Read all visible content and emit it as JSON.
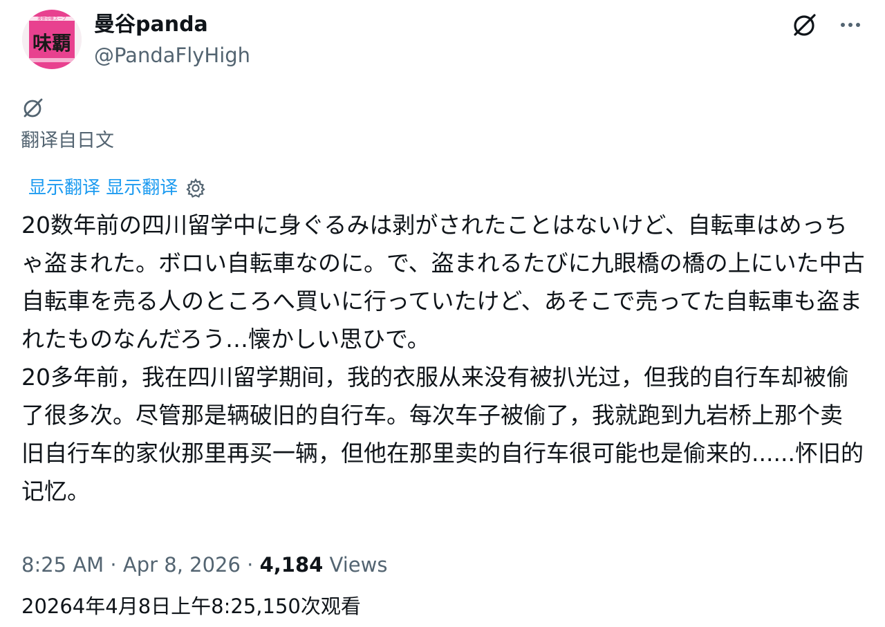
{
  "author": {
    "display_name": "曼谷panda",
    "handle": "@PandaFlyHigh",
    "avatar": {
      "label": "味覇",
      "top_text": "液体中華スープ",
      "bg_color": "#e8418f"
    }
  },
  "header_icons": {
    "grok_icon": "slash-circle-icon",
    "more_icon": "more-horizontal-icon"
  },
  "translation": {
    "icon": "slash-circle-icon",
    "translated_from": "翻译自日文",
    "show_translation": "显示翻译 显示翻译"
  },
  "post": {
    "original_text": "20数年前の四川留学中に身ぐるみは剥がされたことはないけど、自転車はめっちゃ盗まれた。ボロい自転車なのに。で、盗まれるたびに九眼橋の橋の上にいた中古自転車を売る人のところへ買いに行っていたけど、あそこで売ってた自転車も盗まれたものなんだろう…懐かしい思ひで。",
    "translated_text": "20多年前，我在四川留学期间，我的衣服从来没有被扒光过，但我的自行车却被偷了很多次。尽管那是辆破旧的自行车。每次车子被偷了，我就跑到九岩桥上那个卖旧自行车的家伙那里再买一辆，但他在那里卖的自行车很可能也是偷来的......怀旧的记忆。"
  },
  "meta": {
    "time": "8:25 AM",
    "separator": "·",
    "date": "Apr 8, 2026",
    "views_count": "4,184",
    "views_label": "Views",
    "translated_line": "20264年4月8日上午8:25,150次观看"
  },
  "colors": {
    "text_primary": "#0f1419",
    "text_secondary": "#536471",
    "link_blue": "#1d9bf0"
  }
}
